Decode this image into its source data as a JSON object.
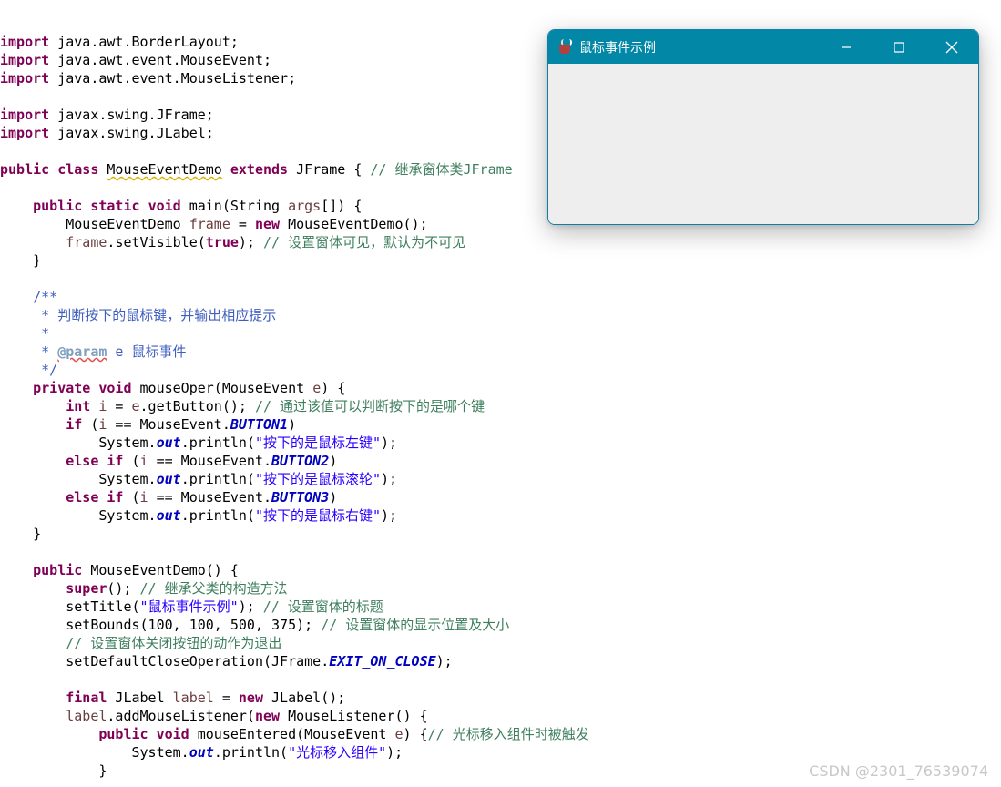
{
  "window": {
    "title": "鼠标事件示例",
    "icon": "java-cup-icon",
    "buttons": [
      "minimize-icon",
      "maximize-icon",
      "close-icon"
    ],
    "accent": "#0287a7"
  },
  "code": [
    [
      {
        "t": "kw",
        "v": "import"
      },
      {
        "t": "plain",
        "v": " java.awt.BorderLayout;"
      }
    ],
    [
      {
        "t": "kw",
        "v": "import"
      },
      {
        "t": "plain",
        "v": " java.awt.event.MouseEvent;"
      }
    ],
    [
      {
        "t": "kw",
        "v": "import"
      },
      {
        "t": "plain",
        "v": " java.awt.event.MouseListener;"
      }
    ],
    [],
    [
      {
        "t": "kw",
        "v": "import"
      },
      {
        "t": "plain",
        "v": " javax.swing.JFrame;"
      }
    ],
    [
      {
        "t": "kw",
        "v": "import"
      },
      {
        "t": "plain",
        "v": " javax.swing.JLabel;"
      }
    ],
    [],
    [
      {
        "t": "kw",
        "v": "public"
      },
      {
        "t": "plain",
        "v": " "
      },
      {
        "t": "kw",
        "v": "class"
      },
      {
        "t": "plain",
        "v": " "
      },
      {
        "t": "squig",
        "v": "MouseEventDemo"
      },
      {
        "t": "plain",
        "v": " "
      },
      {
        "t": "kw",
        "v": "extends"
      },
      {
        "t": "plain",
        "v": " JFrame { "
      },
      {
        "t": "cm",
        "v": "// 继承窗体类JFrame"
      }
    ],
    [],
    [
      {
        "t": "plain",
        "v": "    "
      },
      {
        "t": "kw",
        "v": "public"
      },
      {
        "t": "plain",
        "v": " "
      },
      {
        "t": "kw",
        "v": "static"
      },
      {
        "t": "plain",
        "v": " "
      },
      {
        "t": "kw",
        "v": "void"
      },
      {
        "t": "plain",
        "v": " main(String "
      },
      {
        "t": "var",
        "v": "args"
      },
      {
        "t": "plain",
        "v": "[]) {"
      }
    ],
    [
      {
        "t": "plain",
        "v": "        MouseEventDemo "
      },
      {
        "t": "var",
        "v": "frame"
      },
      {
        "t": "plain",
        "v": " = "
      },
      {
        "t": "kw",
        "v": "new"
      },
      {
        "t": "plain",
        "v": " MouseEventDemo();"
      }
    ],
    [
      {
        "t": "plain",
        "v": "        "
      },
      {
        "t": "var",
        "v": "frame"
      },
      {
        "t": "plain",
        "v": ".setVisible("
      },
      {
        "t": "kw",
        "v": "true"
      },
      {
        "t": "plain",
        "v": "); "
      },
      {
        "t": "cm",
        "v": "// 设置窗体可见，默认为不可见"
      }
    ],
    [
      {
        "t": "plain",
        "v": "    }"
      }
    ],
    [],
    [
      {
        "t": "plain",
        "v": "    "
      },
      {
        "t": "jd",
        "v": "/**"
      }
    ],
    [
      {
        "t": "plain",
        "v": "     "
      },
      {
        "t": "jd",
        "v": "* 判断按下的鼠标键，并输出相应提示"
      }
    ],
    [
      {
        "t": "plain",
        "v": "     "
      },
      {
        "t": "jd",
        "v": "*"
      }
    ],
    [
      {
        "t": "plain",
        "v": "     "
      },
      {
        "t": "jd",
        "v": "* "
      },
      {
        "t": "jdtag",
        "v": "@param"
      },
      {
        "t": "jd",
        "v": " e 鼠标事件"
      }
    ],
    [
      {
        "t": "plain",
        "v": "     "
      },
      {
        "t": "jd",
        "v": "*/"
      }
    ],
    [
      {
        "t": "plain",
        "v": "    "
      },
      {
        "t": "kw",
        "v": "private"
      },
      {
        "t": "plain",
        "v": " "
      },
      {
        "t": "kw",
        "v": "void"
      },
      {
        "t": "plain",
        "v": " mouseOper(MouseEvent "
      },
      {
        "t": "var",
        "v": "e"
      },
      {
        "t": "plain",
        "v": ") {"
      }
    ],
    [
      {
        "t": "plain",
        "v": "        "
      },
      {
        "t": "kw",
        "v": "int"
      },
      {
        "t": "plain",
        "v": " "
      },
      {
        "t": "var",
        "v": "i"
      },
      {
        "t": "plain",
        "v": " = "
      },
      {
        "t": "var",
        "v": "e"
      },
      {
        "t": "plain",
        "v": ".getButton(); "
      },
      {
        "t": "cm",
        "v": "// 通过该值可以判断按下的是哪个键"
      }
    ],
    [
      {
        "t": "plain",
        "v": "        "
      },
      {
        "t": "kw",
        "v": "if"
      },
      {
        "t": "plain",
        "v": " ("
      },
      {
        "t": "var",
        "v": "i"
      },
      {
        "t": "plain",
        "v": " == MouseEvent."
      },
      {
        "t": "field",
        "v": "BUTTON1"
      },
      {
        "t": "plain",
        "v": ")"
      }
    ],
    [
      {
        "t": "plain",
        "v": "            System."
      },
      {
        "t": "field",
        "v": "out"
      },
      {
        "t": "plain",
        "v": ".println("
      },
      {
        "t": "str",
        "v": "\"按下的是鼠标左键\""
      },
      {
        "t": "plain",
        "v": ");"
      }
    ],
    [
      {
        "t": "plain",
        "v": "        "
      },
      {
        "t": "kw",
        "v": "else"
      },
      {
        "t": "plain",
        "v": " "
      },
      {
        "t": "kw",
        "v": "if"
      },
      {
        "t": "plain",
        "v": " ("
      },
      {
        "t": "var",
        "v": "i"
      },
      {
        "t": "plain",
        "v": " == MouseEvent."
      },
      {
        "t": "field",
        "v": "BUTTON2"
      },
      {
        "t": "plain",
        "v": ")"
      }
    ],
    [
      {
        "t": "plain",
        "v": "            System."
      },
      {
        "t": "field",
        "v": "out"
      },
      {
        "t": "plain",
        "v": ".println("
      },
      {
        "t": "str",
        "v": "\"按下的是鼠标滚轮\""
      },
      {
        "t": "plain",
        "v": ");"
      }
    ],
    [
      {
        "t": "plain",
        "v": "        "
      },
      {
        "t": "kw",
        "v": "else"
      },
      {
        "t": "plain",
        "v": " "
      },
      {
        "t": "kw",
        "v": "if"
      },
      {
        "t": "plain",
        "v": " ("
      },
      {
        "t": "var",
        "v": "i"
      },
      {
        "t": "plain",
        "v": " == MouseEvent."
      },
      {
        "t": "field",
        "v": "BUTTON3"
      },
      {
        "t": "plain",
        "v": ")"
      }
    ],
    [
      {
        "t": "plain",
        "v": "            System."
      },
      {
        "t": "field",
        "v": "out"
      },
      {
        "t": "plain",
        "v": ".println("
      },
      {
        "t": "str",
        "v": "\"按下的是鼠标右键\""
      },
      {
        "t": "plain",
        "v": ");"
      }
    ],
    [
      {
        "t": "plain",
        "v": "    }"
      }
    ],
    [],
    [
      {
        "t": "plain",
        "v": "    "
      },
      {
        "t": "kw",
        "v": "public"
      },
      {
        "t": "plain",
        "v": " MouseEventDemo() {"
      }
    ],
    [
      {
        "t": "plain",
        "v": "        "
      },
      {
        "t": "kw",
        "v": "super"
      },
      {
        "t": "plain",
        "v": "(); "
      },
      {
        "t": "cm",
        "v": "// 继承父类的构造方法"
      }
    ],
    [
      {
        "t": "plain",
        "v": "        setTitle("
      },
      {
        "t": "str",
        "v": "\"鼠标事件示例\""
      },
      {
        "t": "plain",
        "v": "); "
      },
      {
        "t": "cm",
        "v": "// 设置窗体的标题"
      }
    ],
    [
      {
        "t": "plain",
        "v": "        setBounds(100, 100, 500, 375); "
      },
      {
        "t": "cm",
        "v": "// 设置窗体的显示位置及大小"
      }
    ],
    [
      {
        "t": "plain",
        "v": "        "
      },
      {
        "t": "cm",
        "v": "// 设置窗体关闭按钮的动作为退出"
      }
    ],
    [
      {
        "t": "plain",
        "v": "        setDefaultCloseOperation(JFrame."
      },
      {
        "t": "field",
        "v": "EXIT_ON_CLOSE"
      },
      {
        "t": "plain",
        "v": ");"
      }
    ],
    [],
    [
      {
        "t": "plain",
        "v": "        "
      },
      {
        "t": "kw",
        "v": "final"
      },
      {
        "t": "plain",
        "v": " JLabel "
      },
      {
        "t": "var",
        "v": "label"
      },
      {
        "t": "plain",
        "v": " = "
      },
      {
        "t": "kw",
        "v": "new"
      },
      {
        "t": "plain",
        "v": " JLabel();"
      }
    ],
    [
      {
        "t": "plain",
        "v": "        "
      },
      {
        "t": "var",
        "v": "label"
      },
      {
        "t": "plain",
        "v": ".addMouseListener("
      },
      {
        "t": "kw",
        "v": "new"
      },
      {
        "t": "plain",
        "v": " MouseListener() {"
      }
    ],
    [
      {
        "t": "plain",
        "v": "            "
      },
      {
        "t": "kw",
        "v": "public"
      },
      {
        "t": "plain",
        "v": " "
      },
      {
        "t": "kw",
        "v": "void"
      },
      {
        "t": "plain",
        "v": " mouseEntered(MouseEvent "
      },
      {
        "t": "var",
        "v": "e"
      },
      {
        "t": "plain",
        "v": ") {"
      },
      {
        "t": "cm",
        "v": "// 光标移入组件时被触发"
      }
    ],
    [
      {
        "t": "plain",
        "v": "                System."
      },
      {
        "t": "field",
        "v": "out"
      },
      {
        "t": "plain",
        "v": ".println("
      },
      {
        "t": "str",
        "v": "\"光标移入组件\""
      },
      {
        "t": "plain",
        "v": ");"
      }
    ],
    [
      {
        "t": "plain",
        "v": "            }"
      }
    ]
  ],
  "watermark": "CSDN @2301_76539074"
}
